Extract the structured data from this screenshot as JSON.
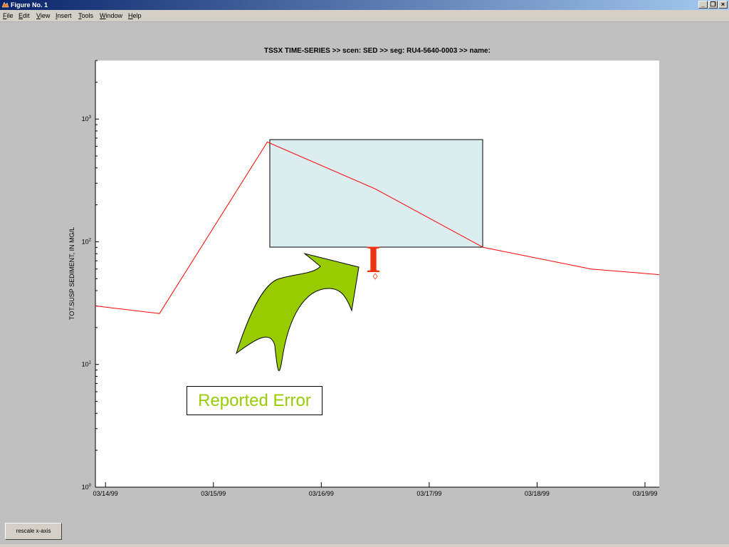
{
  "window": {
    "title": "Figure No. 1",
    "controls": [
      "_",
      "❐",
      "×"
    ]
  },
  "menu": [
    {
      "key": "F",
      "rest": "ile"
    },
    {
      "key": "E",
      "rest": "dit"
    },
    {
      "key": "V",
      "rest": "iew"
    },
    {
      "key": "I",
      "rest": "nsert"
    },
    {
      "key": "T",
      "rest": "ools"
    },
    {
      "key": "W",
      "rest": "indow"
    },
    {
      "key": "H",
      "rest": "elp"
    }
  ],
  "chart_data": {
    "type": "line",
    "title": "TSSX TIME-SERIES >> scen: SED >> seg: RU4-5640-0003 >> name:",
    "ylabel": "TOT.SUSP SEDIMENT, IN MG/L",
    "xlabel": "",
    "yscale": "log",
    "ylim": [
      1,
      3000
    ],
    "xlim": [
      "03/13/99 21:45",
      "03/19/99 03:10"
    ],
    "x_ticks": [
      "03/14/99",
      "03/15/99",
      "03/16/99",
      "03/17/99",
      "03/18/99",
      "03/19/99"
    ],
    "y_ticks": [
      "10^0",
      "10^1",
      "10^2",
      "10^3"
    ],
    "grid": false,
    "series": [
      {
        "color": "#ff0000",
        "x": [
          "03/13/99 21:45",
          "03/14/99 12:00",
          "03/15/99 12:00",
          "03/16/99 12:00",
          "03/17/99 12:00",
          "03/18/99 12:00",
          "03/19/99 03:10"
        ],
        "y": [
          30,
          26,
          650,
          270,
          90,
          60,
          54
        ]
      }
    ],
    "error_point": {
      "x": "03/16/99 12:00",
      "y": 50
    }
  },
  "annotations": {
    "highlight_box_fill": "#dcedef",
    "arrow_fill": "#99cc00",
    "reported_label": "Reported Error",
    "error_symbol": "I",
    "error_color": "#ee3311"
  },
  "buttons": {
    "rescale": "rescale x-axis"
  }
}
